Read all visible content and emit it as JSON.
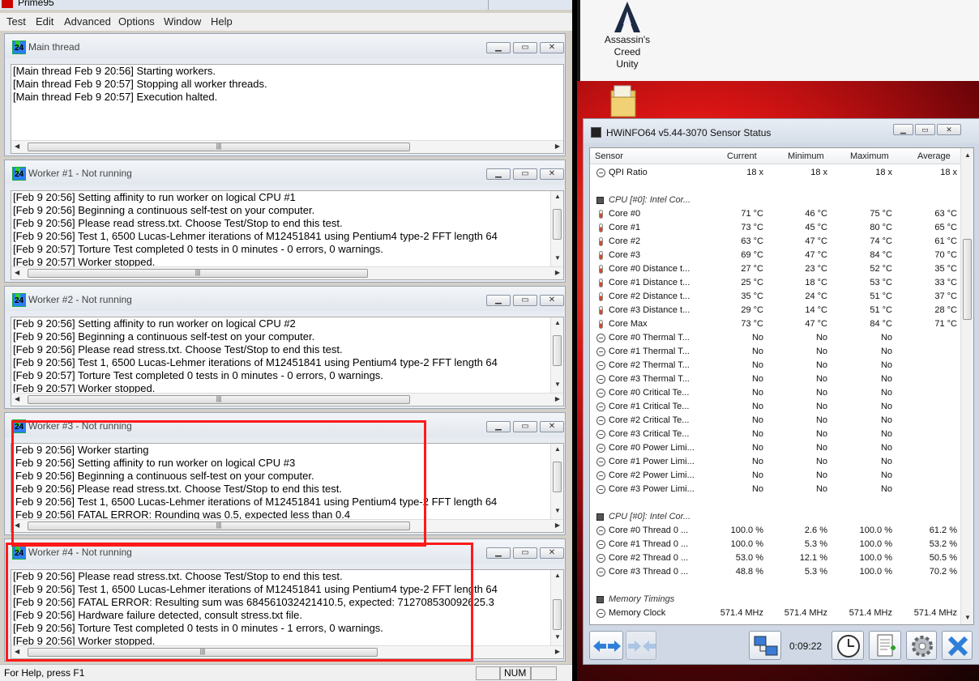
{
  "prime95": {
    "title": "Prime95",
    "menu": [
      "Test",
      "Edit",
      "Advanced",
      "Options",
      "Window",
      "Help"
    ],
    "windows": [
      {
        "title": "Main thread",
        "lines": [
          "[Main thread Feb 9 20:56] Starting workers.",
          "[Main thread Feb 9 20:57] Stopping all worker threads.",
          "[Main thread Feb 9 20:57] Execution halted."
        ]
      },
      {
        "title": "Worker #1 - Not running",
        "lines": [
          "[Feb 9 20:56] Setting affinity to run worker on logical CPU #1",
          "[Feb 9 20:56] Beginning a continuous self-test on your computer.",
          "[Feb 9 20:56] Please read stress.txt.  Choose Test/Stop to end this test.",
          "[Feb 9 20:56] Test 1, 6500 Lucas-Lehmer iterations of M12451841 using Pentium4 type-2 FFT length 64",
          "[Feb 9 20:57] Torture Test completed 0 tests in 0 minutes - 0 errors, 0 warnings.",
          "[Feb 9 20:57] Worker stopped."
        ]
      },
      {
        "title": "Worker #2 - Not running",
        "lines": [
          "[Feb 9 20:56] Setting affinity to run worker on logical CPU #2",
          "[Feb 9 20:56] Beginning a continuous self-test on your computer.",
          "[Feb 9 20:56] Please read stress.txt.  Choose Test/Stop to end this test.",
          "[Feb 9 20:56] Test 1, 6500 Lucas-Lehmer iterations of M12451841 using Pentium4 type-2 FFT length 64",
          "[Feb 9 20:57] Torture Test completed 0 tests in 0 minutes - 0 errors, 0 warnings.",
          "[Feb 9 20:57] Worker stopped."
        ]
      },
      {
        "title": "Worker #3 - Not running",
        "lines": [
          "Feb 9 20:56] Worker starting",
          "Feb 9 20:56] Setting affinity to run worker on logical CPU #3",
          "Feb 9 20:56] Beginning a continuous self-test on your computer.",
          "Feb 9 20:56] Please read stress.txt.  Choose Test/Stop to end this test.",
          "Feb 9 20:56] Test 1, 6500 Lucas-Lehmer iterations of M12451841 using Pentium4 type-2 FFT length 64",
          "Feb 9 20:56] FATAL ERROR: Rounding was 0.5, expected less than 0.4"
        ]
      },
      {
        "title": "Worker #4 - Not running",
        "lines": [
          "[Feb 9 20:56] Please read stress.txt.  Choose Test/Stop to end this test.",
          "[Feb 9 20:56] Test 1, 6500 Lucas-Lehmer iterations of M12451841 using Pentium4 type-2 FFT length 64",
          "[Feb 9 20:56] FATAL ERROR: Resulting sum was 684561032421410.5, expected: 712708530092625.3",
          "[Feb 9 20:56] Hardware failure detected, consult stress.txt file.",
          "[Feb 9 20:56] Torture Test completed 0 tests in 0 minutes - 1 errors, 0 warnings.",
          "[Feb 9 20:56] Worker stopped."
        ]
      }
    ],
    "status_help": "For Help, press F1",
    "status_num": "NUM",
    "highlight_color": "#ff1a1a"
  },
  "desktop": {
    "icon_label_1": "Assassin's Creed",
    "icon_label_2": "Unity"
  },
  "hwinfo": {
    "title": "HWiNFO64 v5.44-3070 Sensor Status",
    "columns": [
      "Sensor",
      "Current",
      "Minimum",
      "Maximum",
      "Average"
    ],
    "rows": [
      {
        "icon": "clock",
        "name": "QPI Ratio",
        "v": [
          "18 x",
          "18 x",
          "18 x",
          "18 x"
        ]
      },
      {
        "type": "spacer"
      },
      {
        "type": "group",
        "name": "CPU [#0]: Intel Cor..."
      },
      {
        "icon": "therm",
        "name": "Core #0",
        "v": [
          "71 °C",
          "46 °C",
          "75 °C",
          "63 °C"
        ]
      },
      {
        "icon": "therm",
        "name": "Core #1",
        "v": [
          "73 °C",
          "45 °C",
          "80 °C",
          "65 °C"
        ]
      },
      {
        "icon": "therm",
        "name": "Core #2",
        "v": [
          "63 °C",
          "47 °C",
          "74 °C",
          "61 °C"
        ]
      },
      {
        "icon": "therm",
        "name": "Core #3",
        "v": [
          "69 °C",
          "47 °C",
          "84 °C",
          "70 °C"
        ]
      },
      {
        "icon": "therm",
        "name": "Core #0 Distance t...",
        "v": [
          "27 °C",
          "23 °C",
          "52 °C",
          "35 °C"
        ]
      },
      {
        "icon": "therm",
        "name": "Core #1 Distance t...",
        "v": [
          "25 °C",
          "18 °C",
          "53 °C",
          "33 °C"
        ]
      },
      {
        "icon": "therm",
        "name": "Core #2 Distance t...",
        "v": [
          "35 °C",
          "24 °C",
          "51 °C",
          "37 °C"
        ]
      },
      {
        "icon": "therm",
        "name": "Core #3 Distance t...",
        "v": [
          "29 °C",
          "14 °C",
          "51 °C",
          "28 °C"
        ]
      },
      {
        "icon": "therm",
        "name": "Core Max",
        "v": [
          "73 °C",
          "47 °C",
          "84 °C",
          "71 °C"
        ]
      },
      {
        "icon": "clock",
        "name": "Core #0 Thermal T...",
        "v": [
          "No",
          "No",
          "No",
          ""
        ]
      },
      {
        "icon": "clock",
        "name": "Core #1 Thermal T...",
        "v": [
          "No",
          "No",
          "No",
          ""
        ]
      },
      {
        "icon": "clock",
        "name": "Core #2 Thermal T...",
        "v": [
          "No",
          "No",
          "No",
          ""
        ]
      },
      {
        "icon": "clock",
        "name": "Core #3 Thermal T...",
        "v": [
          "No",
          "No",
          "No",
          ""
        ]
      },
      {
        "icon": "clock",
        "name": "Core #0 Critical Te...",
        "v": [
          "No",
          "No",
          "No",
          ""
        ]
      },
      {
        "icon": "clock",
        "name": "Core #1 Critical Te...",
        "v": [
          "No",
          "No",
          "No",
          ""
        ]
      },
      {
        "icon": "clock",
        "name": "Core #2 Critical Te...",
        "v": [
          "No",
          "No",
          "No",
          ""
        ]
      },
      {
        "icon": "clock",
        "name": "Core #3 Critical Te...",
        "v": [
          "No",
          "No",
          "No",
          ""
        ]
      },
      {
        "icon": "clock",
        "name": "Core #0 Power Limi...",
        "v": [
          "No",
          "No",
          "No",
          ""
        ]
      },
      {
        "icon": "clock",
        "name": "Core #1 Power Limi...",
        "v": [
          "No",
          "No",
          "No",
          ""
        ]
      },
      {
        "icon": "clock",
        "name": "Core #2 Power Limi...",
        "v": [
          "No",
          "No",
          "No",
          ""
        ]
      },
      {
        "icon": "clock",
        "name": "Core #3 Power Limi...",
        "v": [
          "No",
          "No",
          "No",
          ""
        ]
      },
      {
        "type": "spacer"
      },
      {
        "type": "group",
        "name": "CPU [#0]: Intel Cor..."
      },
      {
        "icon": "clock",
        "name": "Core #0 Thread 0 ...",
        "v": [
          "100.0 %",
          "2.6 %",
          "100.0 %",
          "61.2 %"
        ]
      },
      {
        "icon": "clock",
        "name": "Core #1 Thread 0 ...",
        "v": [
          "100.0 %",
          "5.3 %",
          "100.0 %",
          "53.2 %"
        ]
      },
      {
        "icon": "clock",
        "name": "Core #2 Thread 0 ...",
        "v": [
          "53.0 %",
          "12.1 %",
          "100.0 %",
          "50.5 %"
        ]
      },
      {
        "icon": "clock",
        "name": "Core #3 Thread 0 ...",
        "v": [
          "48.8 %",
          "5.3 %",
          "100.0 %",
          "70.2 %"
        ]
      },
      {
        "type": "spacer"
      },
      {
        "type": "group",
        "name": "Memory Timings"
      },
      {
        "icon": "clock",
        "name": "Memory Clock",
        "v": [
          "571.4 MHz",
          "571.4 MHz",
          "571.4 MHz",
          "571.4 MHz"
        ]
      }
    ],
    "timer": "0:09:22"
  }
}
